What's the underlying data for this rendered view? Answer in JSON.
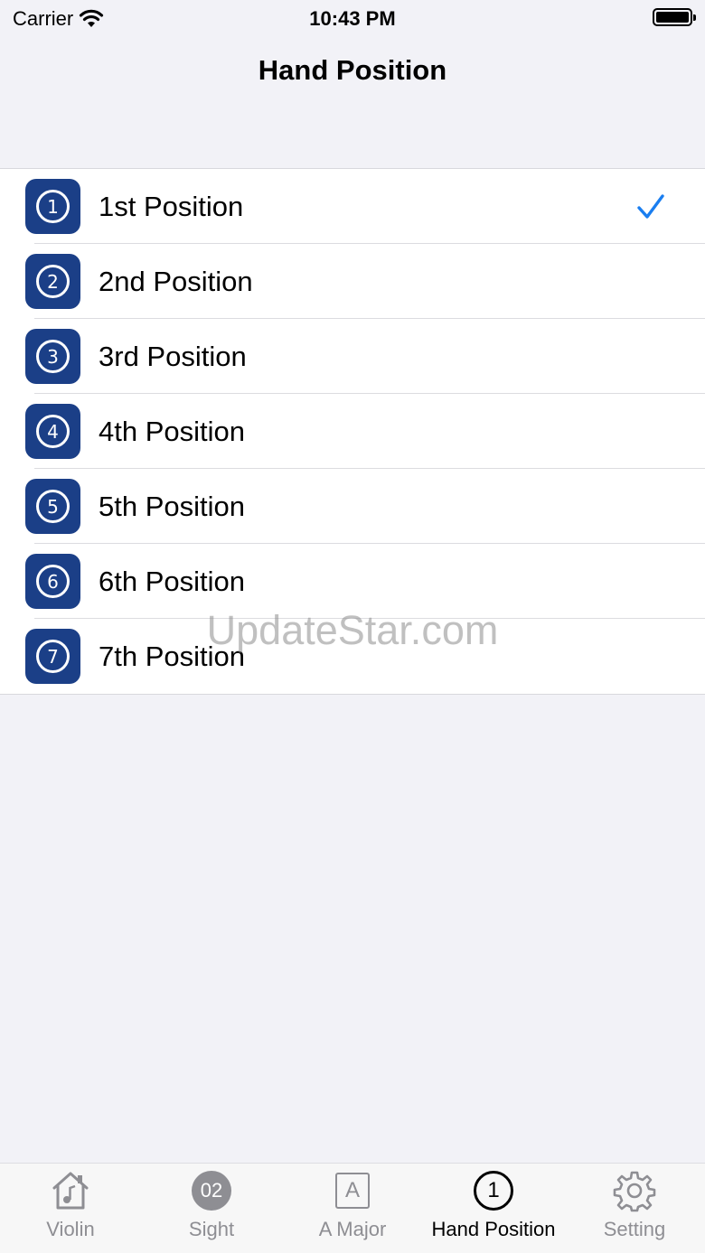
{
  "status_bar": {
    "carrier": "Carrier",
    "time": "10:43 PM"
  },
  "nav": {
    "title": "Hand Position"
  },
  "positions": [
    {
      "number": "1",
      "label": "1st Position",
      "selected": true
    },
    {
      "number": "2",
      "label": "2nd Position",
      "selected": false
    },
    {
      "number": "3",
      "label": "3rd Position",
      "selected": false
    },
    {
      "number": "4",
      "label": "4th Position",
      "selected": false
    },
    {
      "number": "5",
      "label": "5th Position",
      "selected": false
    },
    {
      "number": "6",
      "label": "6th Position",
      "selected": false
    },
    {
      "number": "7",
      "label": "7th Position",
      "selected": false
    }
  ],
  "watermark": "UpdateStar.com",
  "tabs": [
    {
      "label": "Violin",
      "icon": "violin-house-icon",
      "active": false
    },
    {
      "label": "Sight",
      "icon": "sight-badge-icon",
      "badge": "02",
      "active": false
    },
    {
      "label": "A Major",
      "icon": "key-a-icon",
      "glyph": "A",
      "active": false
    },
    {
      "label": "Hand Position",
      "icon": "position-one-icon",
      "glyph": "1",
      "active": true
    },
    {
      "label": "Setting",
      "icon": "gear-icon",
      "active": false
    }
  ],
  "colors": {
    "icon_bg": "#1b3f87",
    "check": "#1a7ef0",
    "inactive_tab": "#8e8e93",
    "background": "#f2f2f7"
  }
}
